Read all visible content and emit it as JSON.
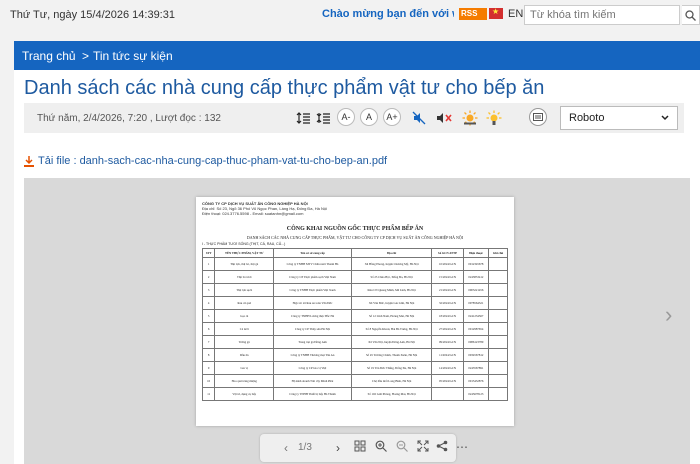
{
  "topbar": {
    "date": "Thứ Tư, ngày 15/4/2026 14:39:31",
    "welcome": "Chào mừng bạn đến với website T",
    "rss_label": "RSS",
    "lang_en": "EN",
    "search_placeholder": "Từ khóa tìm kiếm"
  },
  "breadcrumb": {
    "home": "Trang chủ",
    "separator": ">",
    "section": "Tin tức sự kiện"
  },
  "article": {
    "title": "Danh sách các nhà cung cấp thực phẩm vật tư cho bếp ăn",
    "meta": "Thứ năm, 2/4/2026, 7:20 , Lượt đọc : 132",
    "font_name": "Roboto",
    "tools": {
      "font_decrease": "A-",
      "font_normal": "A",
      "font_increase": "A+"
    },
    "download_label": "Tải file : danh-sach-cac-nha-cung-cap-thuc-pham-vat-tu-cho-bep-an.pdf"
  },
  "viewer": {
    "page_indicator": "1/3",
    "doc_header": [
      "CÔNG TY CP DỊCH VỤ SUẤT ĂN CÔNG NGHIỆP HÀ NỘI",
      "Địa chỉ: Số 23, Ngõ 36 Phố Vũ Ngọc Phan, Láng Hạ, Đống Đa, Hà Nội",
      "Điện thoại: 024.3776.5598 - Email: suatanhn@gmail.com"
    ],
    "doc_title": "CÔNG KHAI NGUỒN GỐC THỰC PHẨM BẾP ĂN",
    "doc_subtitle": "DANH SÁCH CÁC NHÀ CUNG CẤP THỰC PHẨM, VẬT TƯ CHO CÔNG TY CP DỊCH VỤ SUẤT ĂN CÔNG NGHIỆP HÀ NỘI",
    "doc_section": "I - THỰC PHẨM TƯƠI SỐNG (THỊT, CÁ, RAU, CỦ...)",
    "doc_columns": [
      "STT",
      "TÊN THỰC PHẨM, VẬT TƯ",
      "Tên cơ sở cung cấp",
      "Địa chỉ",
      "Số GCN ATTP",
      "Điện thoại",
      "Ghi chú"
    ],
    "doc_rows": [
      [
        "1",
        "Thịt lợn, thịt bò, thịt gà",
        "Công ty TNHH MTV Chăn nuôi Thanh Hà",
        "Xã Hồng Phong, huyện Chương Mỹ, Hà Nội",
        "10/2024/GCN",
        "0912345678",
        ""
      ],
      [
        "2",
        "Thịt bò tươi",
        "Công ty CP Thực phẩm sạch Việt Nam",
        "Số 25 Chùa Bộc, Đống Đa, Hà Nội",
        "15/2024/GCN",
        "0243853412",
        ""
      ],
      [
        "3",
        "Thịt lợn sạch",
        "Công ty TNHH Thực phẩm Việt Xanh",
        "Khu CN Quang Minh, Mê Linh, Hà Nội",
        "21/2024/GCN",
        "0903221456",
        ""
      ],
      [
        "4",
        "Rau củ quả",
        "Hợp tác xã Rau an toàn Văn Đức",
        "Xã Văn Đức, huyện Gia Lâm, Hà Nội",
        "32/2024/GCN",
        "0978564321",
        ""
      ],
      [
        "5",
        "Gạo tẻ",
        "Công ty TNHH Lương thực Bắc Hà",
        "Số 12 Lĩnh Nam, Hoàng Mai, Hà Nội",
        "18/2024/GCN",
        "0241234567",
        ""
      ],
      [
        "6",
        "Cá tươi",
        "Công ty CP Thủy sản Hà Nội",
        "Số 8 Nguyễn Khoái, Hai Bà Trưng, Hà Nội",
        "27/2024/GCN",
        "0912987654",
        ""
      ],
      [
        "7",
        "Trứng gà",
        "Trang trại gà Đồng Anh",
        "Xã Vân Nội, huyện Đông Anh, Hà Nội",
        "09/2024/GCN",
        "0986123789",
        ""
      ],
      [
        "8",
        "Dầu ăn",
        "Công ty TNHH Thương mại Tân An",
        "Số 45 Trường Chinh, Thanh Xuân, Hà Nội",
        "11/2024/GCN",
        "0934567812",
        ""
      ],
      [
        "9",
        "Gia vị",
        "Công ty CP Gia vị Việt",
        "Số 19 Tôn Đức Thắng, Đống Đa, Hà Nội",
        "14/2024/GCN",
        "0243567891",
        ""
      ],
      [
        "10",
        "Hoa quả tráng miệng",
        "Hộ kinh doanh Trái cây Minh Phát",
        "Chợ đầu mối Long Biên, Hà Nội",
        "05/2024/GCN",
        "0915432876",
        ""
      ],
      [
        "11",
        "Vật tư, dụng cụ bếp",
        "Công ty TNHH Thiết bị bếp Hà Thành",
        "Số 102 Giải Phóng, Hoàng Mai, Hà Nội",
        "",
        "0245678123",
        ""
      ]
    ]
  }
}
